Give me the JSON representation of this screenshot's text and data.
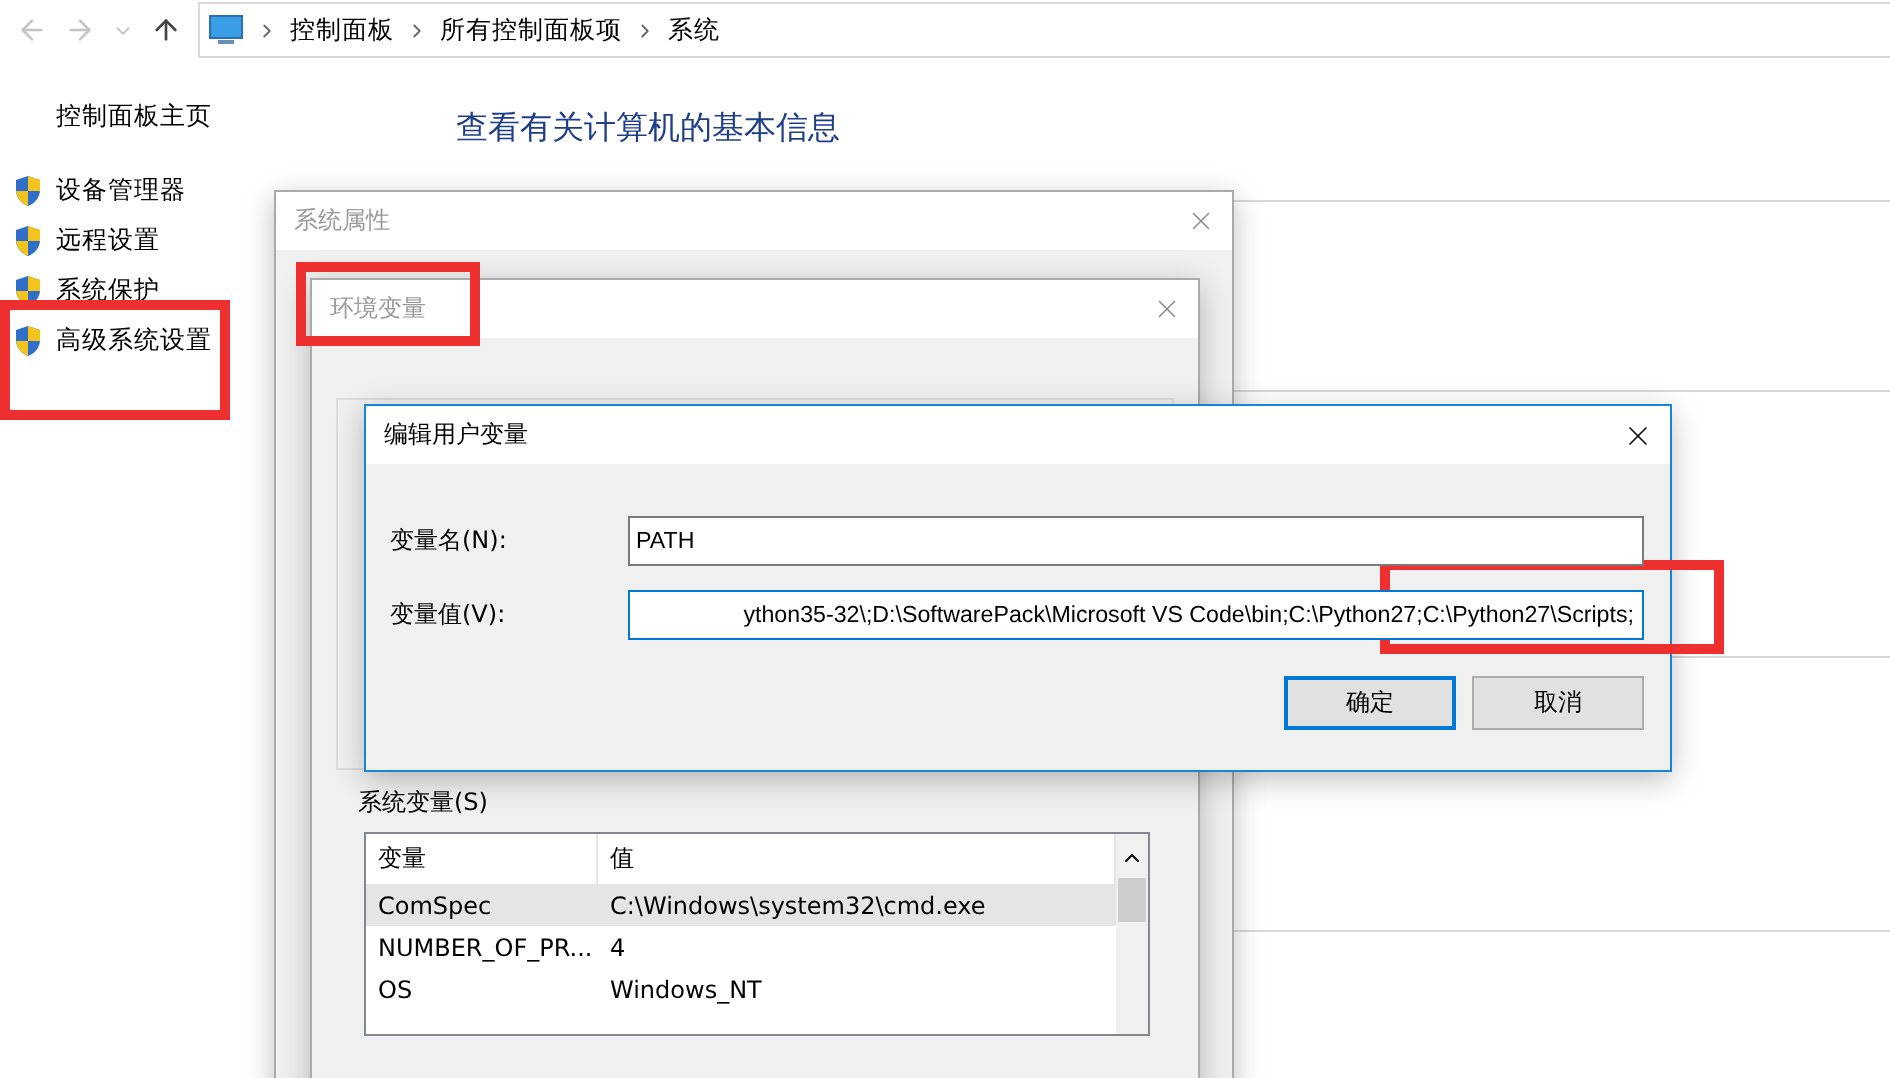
{
  "address_bar": {
    "breadcrumbs": [
      "控制面板",
      "所有控制面板项",
      "系统"
    ]
  },
  "sidebar": {
    "home": "控制面板主页",
    "items": [
      "设备管理器",
      "远程设置",
      "系统保护",
      "高级系统设置"
    ]
  },
  "main": {
    "title": "查看有关计算机的基本信息"
  },
  "system_properties": {
    "title": "系统属性"
  },
  "environment_variables": {
    "title": "环境变量",
    "system_variables": {
      "label": "系统变量(S)",
      "columns": [
        "变量",
        "值"
      ],
      "rows": [
        {
          "name": "ComSpec",
          "value": "C:\\Windows\\system32\\cmd.exe",
          "selected": true
        },
        {
          "name": "NUMBER_OF_PR...",
          "value": "4",
          "selected": false
        },
        {
          "name": "OS",
          "value": "Windows_NT",
          "selected": false
        }
      ]
    }
  },
  "edit_user_variable": {
    "title": "编辑用户变量",
    "fields": [
      {
        "label": "变量名(N):",
        "value": "PATH",
        "focused": false
      },
      {
        "label": "变量值(V):",
        "value": "ython35-32\\;D:\\SoftwarePack\\Microsoft VS Code\\bin;C:\\Python27;C:\\Python27\\Scripts;",
        "focused": true
      }
    ],
    "buttons": [
      {
        "label": "确定",
        "default": true
      },
      {
        "label": "取消",
        "default": false
      }
    ]
  }
}
